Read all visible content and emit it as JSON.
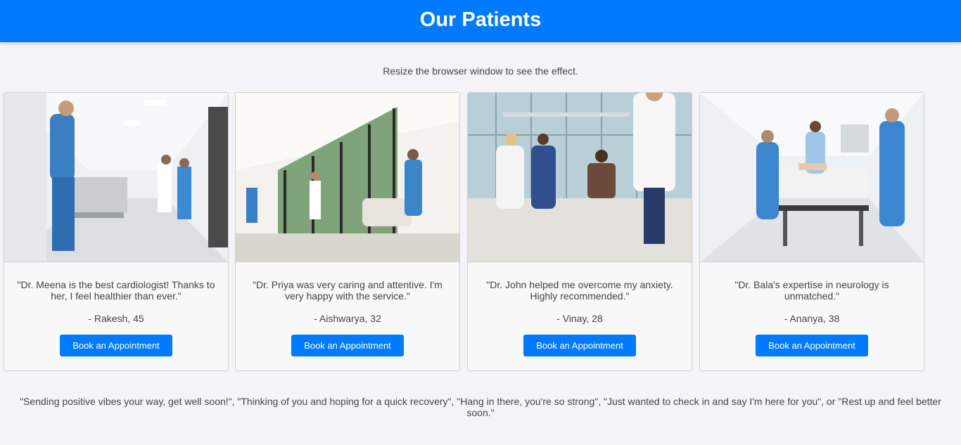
{
  "header": {
    "title": "Our Patients"
  },
  "intro": "Resize the browser window to see the effect.",
  "cards": [
    {
      "quote": "\"Dr. Meena is the best cardiologist! Thanks to her, I feel healthier than ever.\"",
      "author": "- Rakesh, 45",
      "button": "Book an Appointment"
    },
    {
      "quote": "\"Dr. Priya was very caring and attentive. I'm very happy with the service.\"",
      "author": "- Aishwarya, 32",
      "button": "Book an Appointment"
    },
    {
      "quote": "\"Dr. John helped me overcome my anxiety. Highly recommended.\"",
      "author": "- Vinay, 28",
      "button": "Book an Appointment"
    },
    {
      "quote": "\"Dr. Bala's expertise in neurology is unmatched.\"",
      "author": "- Ananya, 38",
      "button": "Book an Appointment"
    }
  ],
  "footer": "\"Sending positive vibes your way, get well soon!\", \"Thinking of you and hoping for a quick recovery\", \"Hang in there, you're so strong\", \"Just wanted to check in and say I'm here for you\", or \"Rest up and feel better soon.\"",
  "colors": {
    "accent": "#007bff",
    "background": "#f4f4f8",
    "card": "#f8f8f8"
  }
}
